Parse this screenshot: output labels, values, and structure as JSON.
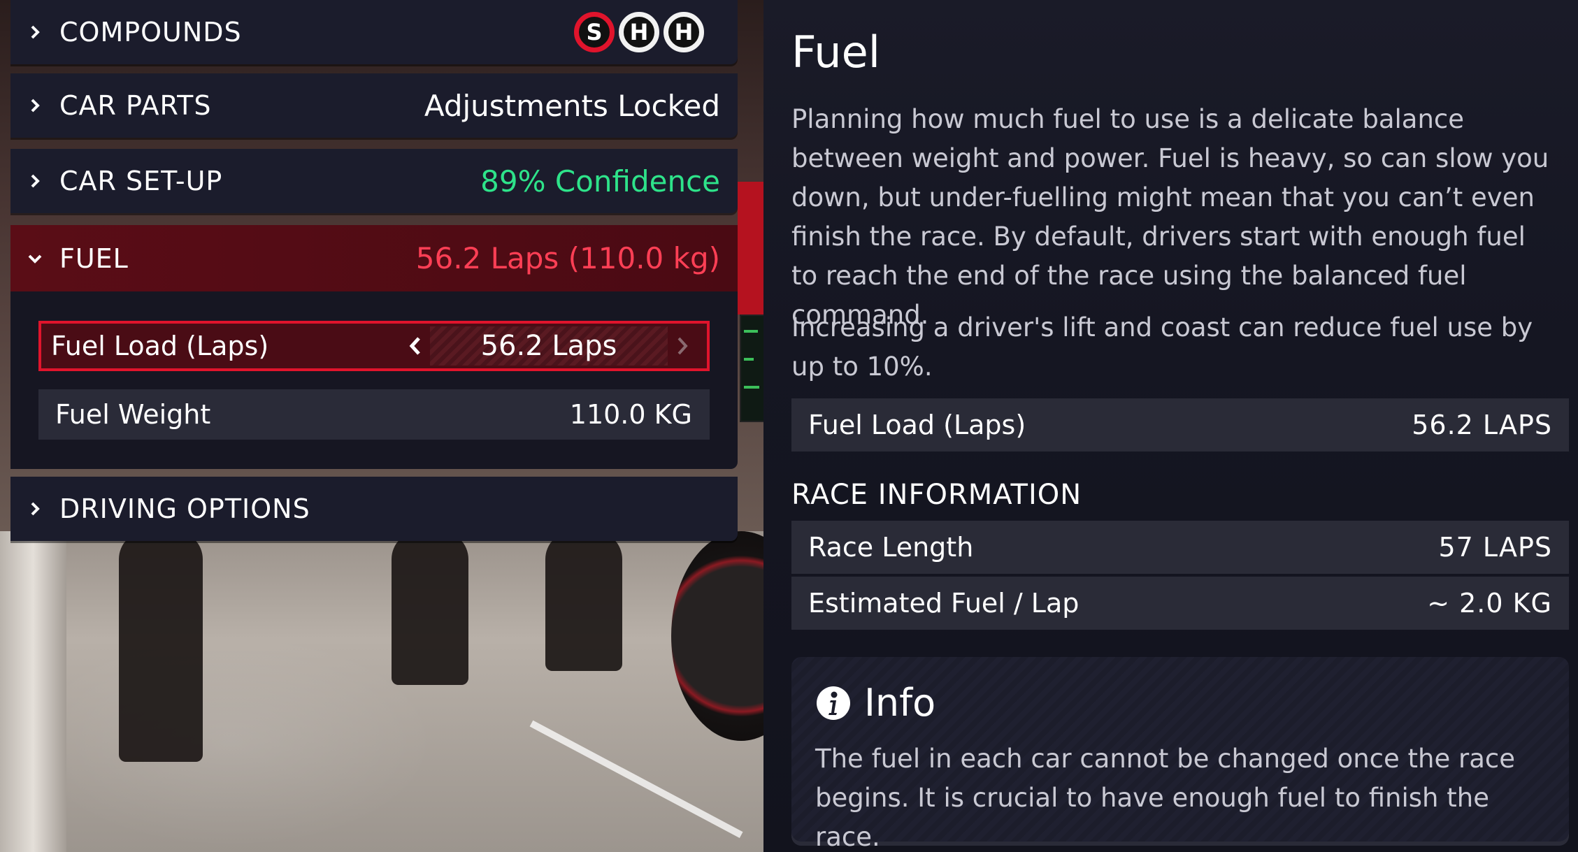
{
  "menu": {
    "compounds": {
      "label": "COMPOUNDS",
      "tyres": [
        "S",
        "H",
        "H"
      ]
    },
    "car_parts": {
      "label": "CAR PARTS",
      "value": "Adjustments Locked"
    },
    "car_setup": {
      "label": "CAR SET-UP",
      "value": "89% Confidence"
    },
    "fuel": {
      "label": "FUEL",
      "value": "56.2 Laps (110.0 kg)",
      "fuel_load": {
        "label": "Fuel Load (Laps)",
        "value": "56.2 Laps"
      },
      "fuel_weight": {
        "label": "Fuel Weight",
        "value": "110.0 KG"
      }
    },
    "driving_options": {
      "label": "DRIVING OPTIONS"
    }
  },
  "panel": {
    "title": "Fuel",
    "paragraph1": "Planning how much fuel to use is a delicate balance between weight and power. Fuel is heavy, so can slow you down, but under-fuelling might mean that you can’t even finish the race. By default, drivers start with enough fuel to reach the end of the race using the balanced fuel command.",
    "paragraph2": "Increasing a driver's lift and coast can reduce fuel use by up to 10%.",
    "fuel_load": {
      "label": "Fuel Load (Laps)",
      "value": "56.2 LAPS"
    },
    "race_info_heading": "RACE INFORMATION",
    "race_length": {
      "label": "Race Length",
      "value": "57 LAPS"
    },
    "est_fuel": {
      "label": "Estimated Fuel / Lap",
      "value": "~ 2.0 KG"
    },
    "info": {
      "title": "Info",
      "body": "The fuel in each car cannot be changed once the race begins. It is crucial to have enough fuel to finish the race."
    }
  },
  "colors": {
    "accent_red": "#e0142c",
    "value_green": "#2ee38a",
    "value_red": "#ff3f55",
    "panel_bg": "#1b1c2c"
  }
}
